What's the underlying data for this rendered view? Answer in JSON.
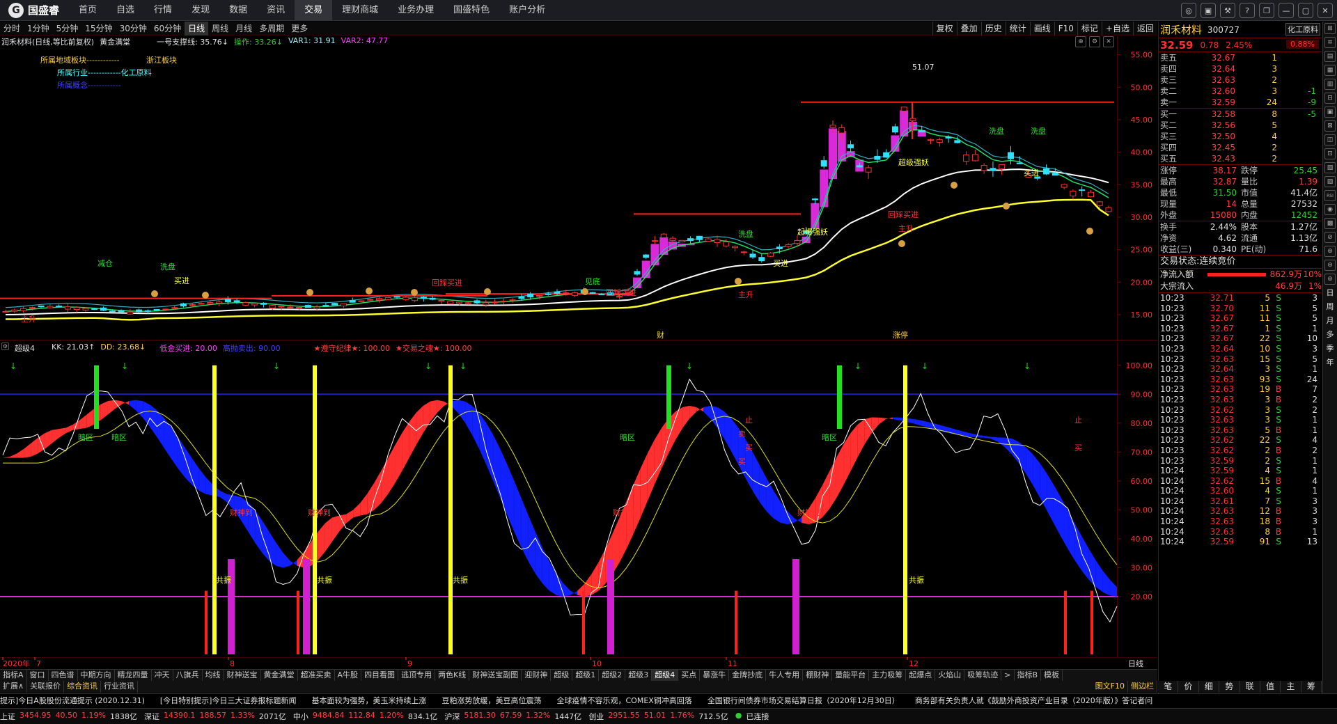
{
  "app": {
    "logo": "国盛睿",
    "nav": [
      "首页",
      "自选",
      "行情",
      "发现",
      "数据",
      "资讯",
      "交易",
      "理财商城",
      "业务办理",
      "国盛特色",
      "账户分析"
    ],
    "nav_active": 6,
    "window_buttons": [
      "◎",
      "▣",
      "⚒",
      "?",
      "❐",
      "—",
      "▢",
      "✕"
    ]
  },
  "periods": [
    "分时",
    "1分钟",
    "5分钟",
    "15分钟",
    "30分钟",
    "60分钟",
    "日线",
    "周线",
    "月线",
    "多周期",
    "更多"
  ],
  "period_active": 6,
  "right_tools": [
    "复权",
    "叠加",
    "历史",
    "统计",
    "画线",
    "F10",
    "标记",
    "+自选",
    "返回"
  ],
  "main_header": {
    "stock": "润禾材料(日线,等比前复权)",
    "indicator": "黄金满堂",
    "support": "一号支撑线: 35.76↓",
    "op": "操作: 33.26↓",
    "var1": "VAR1: 31.91",
    "var2": "VAR2: 47.77",
    "info1": "所属地域板块------------",
    "info1v": "浙江板块",
    "info2": "所属行业------------化工原料",
    "info3": "所属概念------------"
  },
  "sub_header": {
    "name": "超级4",
    "kk": "KK: 21.03↑",
    "dd": "DD: 23.68↓",
    "low": "低金买进: 20.00",
    "high": "高抛卖出: 90.00",
    "rule": "★遵守纪律★: 100.00",
    "way": "★交易之魂★: 100.00"
  },
  "chart_data": [
    {
      "type": "candlestick",
      "title": "润禾材料(日线,等比前复权)",
      "y_ticks": [
        15,
        20,
        25,
        30,
        35,
        40,
        45,
        50,
        55
      ],
      "ylim": [
        12,
        57
      ],
      "annotations": [
        "51.07",
        "财",
        "涨停"
      ],
      "markers": [
        "减仓",
        "洗盘",
        "买进",
        "主升",
        "回踩买进",
        "见底",
        "超级强妖",
        "起爆强妖",
        "洗盘"
      ],
      "support_line_last": 35.76,
      "op_line_last": 33.26
    },
    {
      "type": "line",
      "title": "超级4",
      "y_ticks": [
        20,
        30,
        40,
        50,
        60,
        70,
        80,
        90,
        100
      ],
      "ylim": [
        0,
        105
      ],
      "kk_last": 21.03,
      "dd_last": 23.68,
      "low_line": 20,
      "high_line": 90,
      "labels": [
        "暗区",
        "财神到",
        "共振",
        "止",
        "卖",
        "买"
      ]
    }
  ],
  "x_axis": [
    "2020年",
    "7",
    "8",
    "9",
    "10",
    "11",
    "12"
  ],
  "x_axis_right": "日线",
  "tabs1": [
    "指标A",
    "窗口",
    "四色谱",
    "中期方向",
    "精龙四量",
    "冲天",
    "八旗兵",
    "均线",
    "财神送宝",
    "黄金满堂",
    "超准买卖",
    "A牛股",
    "四目看图",
    "逃顶专用",
    "两色K线",
    "财神送宝副图",
    "迎财神",
    "超级",
    "超级1",
    "超级2",
    "超级3",
    "超级4",
    "买点",
    "暴涨牛",
    "金牌抄底",
    "牛人专用",
    "棚财神",
    "量能平台",
    "主力吸筹",
    "起爆点",
    "火焰山",
    "吸筹轨迹",
    ">",
    "指标B",
    "模板"
  ],
  "tabs1_active": 21,
  "tabs2": [
    "扩展∧",
    "关联报价",
    "综合资讯",
    "行业资讯"
  ],
  "tabs2_active": 2,
  "tabs2_right": "图文F10",
  "tabs2_right2": "侧边栏",
  "ticker": [
    "提示]今日A股股份流通提示 (2020.12.31)",
    "[今日特别提示]今日三大证券报标题新闻",
    "基本面较为强势，美玉米持续上涨",
    "豆粕涨势放缓，美豆高位震荡",
    "全球疫情不容乐观，COMEX铜冲高回落",
    "全国银行间债券市场交易结算日报（2020年12月30日）",
    "商务部有关负责人就《鼓励外商投资产业目录（2020年版）》答记者问"
  ],
  "indices": [
    {
      "name": "上证",
      "v": "3454.95",
      "c": "40.50",
      "p": "1.19%",
      "a": "1838亿"
    },
    {
      "name": "深证",
      "v": "14390.1",
      "c": "188.57",
      "p": "1.33%",
      "a": "2071亿"
    },
    {
      "name": "中小",
      "v": "9484.84",
      "c": "112.84",
      "p": "1.20%",
      "a": "834.1亿"
    },
    {
      "name": "沪深",
      "v": "5181.30",
      "c": "67.59",
      "p": "1.32%",
      "a": "1447亿"
    },
    {
      "name": "创业",
      "v": "2951.55",
      "c": "51.01",
      "p": "1.76%",
      "a": "712.5亿"
    }
  ],
  "status": "已连接",
  "quote": {
    "name": "润禾材料",
    "code": "300727",
    "sector": "化工原料",
    "price": "32.59",
    "change": "0.78",
    "pct": "2.45%",
    "pct_badge": "0.88%",
    "sells": [
      {
        "l": "卖五",
        "p": "32.67",
        "v": "1",
        "d": ""
      },
      {
        "l": "卖四",
        "p": "32.64",
        "v": "3",
        "d": ""
      },
      {
        "l": "卖三",
        "p": "32.63",
        "v": "2",
        "d": ""
      },
      {
        "l": "卖二",
        "p": "32.60",
        "v": "3",
        "d": "-1"
      },
      {
        "l": "卖一",
        "p": "32.59",
        "v": "24",
        "d": "-9"
      }
    ],
    "buys": [
      {
        "l": "买一",
        "p": "32.58",
        "v": "8",
        "d": "-5"
      },
      {
        "l": "买二",
        "p": "32.56",
        "v": "5",
        "d": ""
      },
      {
        "l": "买三",
        "p": "32.50",
        "v": "4",
        "d": ""
      },
      {
        "l": "买四",
        "p": "32.45",
        "v": "2",
        "d": ""
      },
      {
        "l": "买五",
        "p": "32.43",
        "v": "2",
        "d": ""
      }
    ],
    "stats": [
      {
        "k1": "涨停",
        "v1": "38.17",
        "k2": "跌停",
        "v2": "25.45",
        "c1": "up",
        "c2": "down"
      },
      {
        "k1": "最高",
        "v1": "32.87",
        "k2": "量比",
        "v2": "1.39",
        "c1": "up",
        "c2": "up"
      },
      {
        "k1": "最低",
        "v1": "31.50",
        "k2": "市值",
        "v2": "41.4亿",
        "c1": "down",
        "c2": "wht"
      },
      {
        "k1": "现量",
        "v1": "14",
        "k2": "总量",
        "v2": "27532",
        "c1": "up",
        "c2": "wht"
      },
      {
        "k1": "外盘",
        "v1": "15080",
        "k2": "内盘",
        "v2": "12452",
        "c1": "up",
        "c2": "down"
      }
    ],
    "stats2": [
      {
        "k1": "换手",
        "v1": "2.44%",
        "k2": "股本",
        "v2": "1.27亿"
      },
      {
        "k1": "净资",
        "v1": "4.62",
        "k2": "流通",
        "v2": "1.13亿"
      },
      {
        "k1": "收益(三)",
        "v1": "0.340",
        "k2": "PE(动)",
        "v2": "71.6"
      }
    ],
    "trade_state_label": "交易状态:",
    "trade_state": "连续竞价",
    "net_in_label": "净流入额",
    "net_in": "862.9万",
    "net_in_pct": "10%",
    "block_label": "大宗流入",
    "block": "46.9万",
    "block_pct": "1%",
    "trades": [
      {
        "t": "10:23",
        "p": "32.71",
        "v": "5",
        "s": "S",
        "n": "3"
      },
      {
        "t": "10:23",
        "p": "32.70",
        "v": "11",
        "s": "S",
        "n": "5"
      },
      {
        "t": "10:23",
        "p": "32.67",
        "v": "11",
        "s": "S",
        "n": "5"
      },
      {
        "t": "10:23",
        "p": "32.67",
        "v": "1",
        "s": "S",
        "n": "1"
      },
      {
        "t": "10:23",
        "p": "32.67",
        "v": "22",
        "s": "S",
        "n": "10"
      },
      {
        "t": "10:23",
        "p": "32.64",
        "v": "10",
        "s": "S",
        "n": "3"
      },
      {
        "t": "10:23",
        "p": "32.63",
        "v": "15",
        "s": "S",
        "n": "5"
      },
      {
        "t": "10:23",
        "p": "32.64",
        "v": "3",
        "s": "S",
        "n": "1"
      },
      {
        "t": "10:23",
        "p": "32.63",
        "v": "93",
        "s": "S",
        "n": "24"
      },
      {
        "t": "10:23",
        "p": "32.63",
        "v": "19",
        "s": "B",
        "n": "7"
      },
      {
        "t": "10:23",
        "p": "32.63",
        "v": "3",
        "s": "B",
        "n": "2"
      },
      {
        "t": "10:23",
        "p": "32.62",
        "v": "3",
        "s": "S",
        "n": "2"
      },
      {
        "t": "10:23",
        "p": "32.63",
        "v": "3",
        "s": "S",
        "n": "1"
      },
      {
        "t": "10:23",
        "p": "32.63",
        "v": "5",
        "s": "B",
        "n": "1"
      },
      {
        "t": "10:23",
        "p": "32.62",
        "v": "22",
        "s": "S",
        "n": "4"
      },
      {
        "t": "10:23",
        "p": "32.62",
        "v": "2",
        "s": "B",
        "n": "2"
      },
      {
        "t": "10:23",
        "p": "32.59",
        "v": "2",
        "s": "S",
        "n": "1"
      },
      {
        "t": "10:24",
        "p": "32.59",
        "v": "4",
        "s": "S",
        "n": "1"
      },
      {
        "t": "10:24",
        "p": "32.62",
        "v": "15",
        "s": "B",
        "n": "4"
      },
      {
        "t": "10:24",
        "p": "32.60",
        "v": "4",
        "s": "S",
        "n": "1"
      },
      {
        "t": "10:24",
        "p": "32.61",
        "v": "7",
        "s": "S",
        "n": "3"
      },
      {
        "t": "10:24",
        "p": "32.63",
        "v": "12",
        "s": "B",
        "n": "3"
      },
      {
        "t": "10:24",
        "p": "32.63",
        "v": "18",
        "s": "B",
        "n": "3"
      },
      {
        "t": "10:24",
        "p": "32.63",
        "v": "8",
        "s": "B",
        "n": "1"
      },
      {
        "t": "10:24",
        "p": "32.59",
        "v": "91",
        "s": "S",
        "n": "13"
      }
    ],
    "bottom_tabs": [
      "笔",
      "价",
      "细",
      "势",
      "联",
      "值",
      "主",
      "筹"
    ]
  },
  "vtools_text": [
    "日",
    "周",
    "月",
    "多",
    "季",
    "年"
  ]
}
